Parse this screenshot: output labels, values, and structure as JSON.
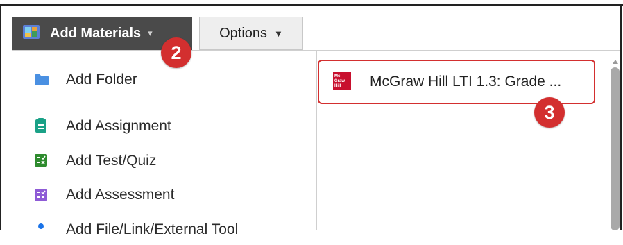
{
  "toolbar": {
    "add_materials": {
      "label": "Add Materials",
      "icon": "add-materials-icon",
      "caret": "▾"
    },
    "options": {
      "label": "Options",
      "caret": "▼"
    }
  },
  "callouts": {
    "two": "2",
    "three": "3"
  },
  "menu": {
    "items": [
      {
        "label": "Add Folder",
        "icon": "folder-icon",
        "color": "#4a90e2"
      },
      {
        "label": "Add Assignment",
        "icon": "assignment-icon",
        "color": "#1aa187"
      },
      {
        "label": "Add Test/Quiz",
        "icon": "test-quiz-icon",
        "color": "#2e8b2e"
      },
      {
        "label": "Add Assessment",
        "icon": "assessment-icon",
        "color": "#8e5bd6"
      },
      {
        "label": "Add File/Link/External Tool",
        "icon": "file-link-icon",
        "color": "#1a73e8"
      }
    ]
  },
  "results": {
    "items": [
      {
        "label": "McGraw Hill LTI 1.3: Grade ...",
        "logo_text": "Mc Graw Hill",
        "logo_color": "#c8102e"
      }
    ]
  },
  "colors": {
    "highlight": "#d32f2f",
    "dark_button": "#4a4a4a"
  }
}
